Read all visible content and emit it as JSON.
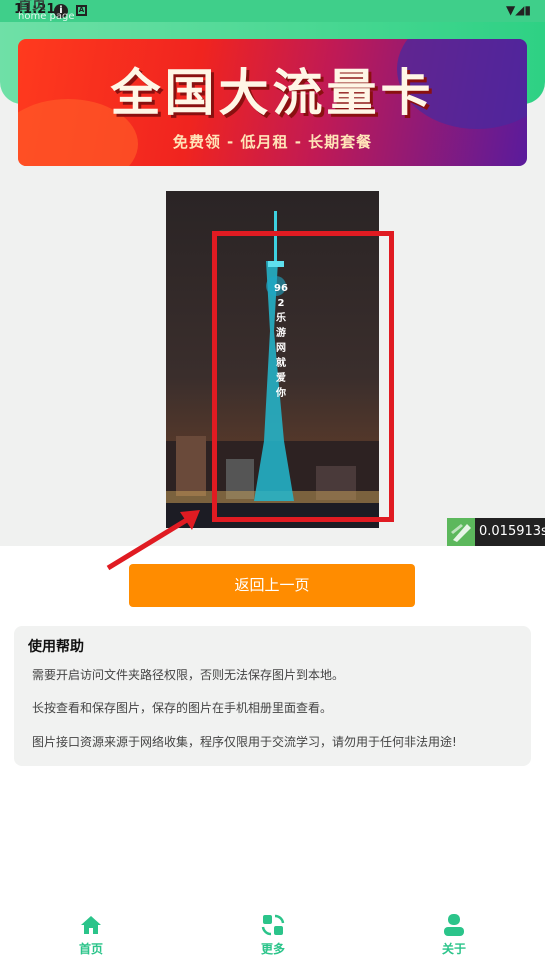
{
  "status_bar": {
    "time": "11:21",
    "info_glyph": "i",
    "a_glyph": "A",
    "right_glyphs": "▼◢▮"
  },
  "header": {
    "title": "首页",
    "subtitle": "home page"
  },
  "banner": {
    "title": "全国大流量卡",
    "subtitle": "免费领 - 低月租 - 长期套餐"
  },
  "photo": {
    "tower_caption": [
      "96",
      "2",
      "乐",
      "游",
      "网",
      "就",
      "爱",
      "你"
    ]
  },
  "speed_badge": {
    "value": "0.015913s"
  },
  "back_button": {
    "label": "返回上一页"
  },
  "help": {
    "title": "使用帮助",
    "lines": [
      "需要开启访问文件夹路径权限，否则无法保存图片到本地。",
      "长按查看和保存图片，保存的图片在手机相册里面查看。",
      "图片接口资源来源于网络收集，程序仅限用于交流学习，请勿用于任何非法用途!"
    ]
  },
  "bottom_nav": {
    "items": [
      {
        "label": "首页",
        "icon": "home-icon"
      },
      {
        "label": "更多",
        "icon": "more-icon"
      },
      {
        "label": "关于",
        "icon": "user-icon"
      }
    ]
  },
  "colors": {
    "accent": "#2bc48a",
    "button": "#ff8c00",
    "highlight": "#e01b22"
  }
}
